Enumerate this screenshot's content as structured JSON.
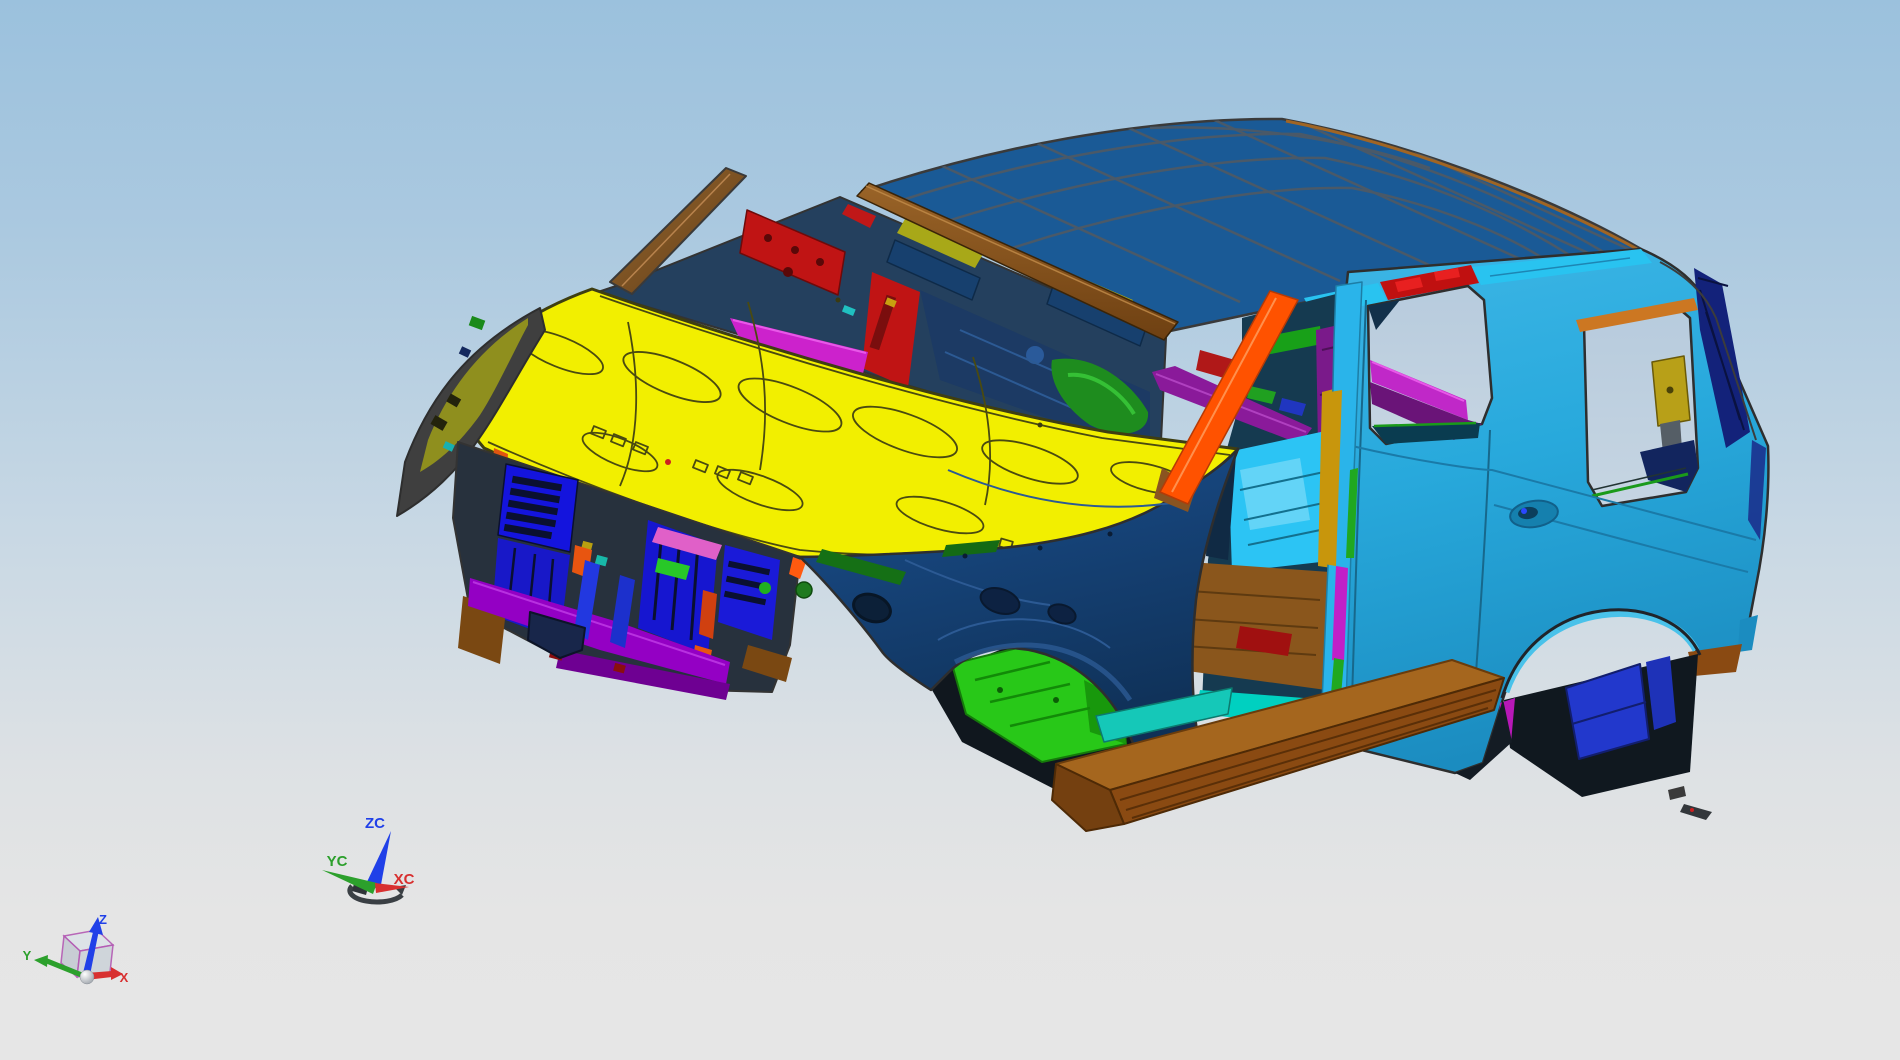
{
  "viewport": {
    "type": "cad-3d-graphics-window",
    "view": "front-left isometric",
    "model": "SUV body-in-white assembly"
  },
  "colors": {
    "background_top": "#9bc1dd",
    "background_mid": "#c8d8e4",
    "background_bottom": "#e6e6e6",
    "outline_gray": "#3a3a3a",
    "hood_yellow": "#f2ef00",
    "roof_blue": "#1a5a96",
    "body_cyan": "#28a9dc",
    "fender_navy": "#16457e",
    "left_fender_olive": "#8f8f1e",
    "header_brown": "#8a5a20",
    "pillar_orange": "#ff5200",
    "bpillar_cyan": "#2ab4ea",
    "rocker_top_brown": "#a5661e",
    "rocker_face_brown": "#8a4a12",
    "floor_green": "#28c818",
    "floor_brown": "#8a561c",
    "floor_cyan": "#2cc4f4",
    "radiator_blue": "#1414dd",
    "bumper_violet": "#9400c4",
    "beam_red": "#c01414",
    "cowl_magenta": "#cc22cc",
    "trim_purple": "#7a1a8a",
    "cargo_magenta": "#c028c8",
    "gold": "#c8960c",
    "axis_x": "#d83030",
    "axis_y": "#2ca02c",
    "axis_z": "#2040e8"
  },
  "model_parts": [
    {
      "name": "hood",
      "color": "#f2ef00"
    },
    {
      "name": "roof-panel",
      "color": "#1a5a96"
    },
    {
      "name": "body-side",
      "color": "#28a9dc"
    },
    {
      "name": "front-fender",
      "color": "#16457e"
    },
    {
      "name": "left-fender",
      "color": "#8f8f1e"
    },
    {
      "name": "windshield-header",
      "color": "#8a5a20"
    },
    {
      "name": "a-pillar",
      "color": "#ff5200"
    },
    {
      "name": "b-pillar",
      "color": "#2ab4ea"
    },
    {
      "name": "rocker-step",
      "color": "#8a4a12"
    },
    {
      "name": "front-floor",
      "color": "#28c818"
    },
    {
      "name": "mid-floor",
      "color": "#8a561c"
    },
    {
      "name": "rear-floor",
      "color": "#2cc4f4"
    },
    {
      "name": "radiator-support",
      "color": "#1414dd"
    },
    {
      "name": "bumper-beam",
      "color": "#9400c4"
    },
    {
      "name": "ip-beam",
      "color": "#c01414"
    },
    {
      "name": "cowl-trim",
      "color": "#cc22cc"
    },
    {
      "name": "interior-trim",
      "color": "#7a1a8a"
    }
  ],
  "wcs_triad": {
    "z_label": "ZC",
    "y_label": "YC",
    "x_label": "XC"
  },
  "abs_triad": {
    "z_label": "Z",
    "y_label": "Y",
    "x_label": "X"
  }
}
